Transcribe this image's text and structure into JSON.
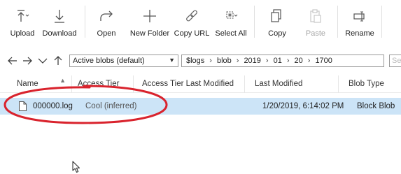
{
  "toolbar": {
    "buttons": [
      {
        "id": "upload",
        "label": "Upload",
        "icon": "upload-icon",
        "enabled": true
      },
      {
        "id": "download",
        "label": "Download",
        "icon": "download-icon",
        "enabled": true
      },
      {
        "id": "open",
        "label": "Open",
        "icon": "open-icon",
        "enabled": true
      },
      {
        "id": "new_folder",
        "label": "New Folder",
        "icon": "plus-icon",
        "enabled": true
      },
      {
        "id": "copy_url",
        "label": "Copy URL",
        "icon": "link-icon",
        "enabled": true
      },
      {
        "id": "select_all",
        "label": "Select All",
        "icon": "select-all-icon",
        "enabled": true
      },
      {
        "id": "copy",
        "label": "Copy",
        "icon": "copy-icon",
        "enabled": true
      },
      {
        "id": "paste",
        "label": "Paste",
        "icon": "paste-icon",
        "enabled": false
      },
      {
        "id": "rename",
        "label": "Rename",
        "icon": "rename-icon",
        "enabled": true
      }
    ]
  },
  "address_bar": {
    "view_filter": "Active blobs (default)",
    "breadcrumb": [
      "$logs",
      "blob",
      "2019",
      "01",
      "20",
      "1700"
    ],
    "search_placeholder": "Sea"
  },
  "table": {
    "columns": [
      "Name",
      "Access Tier",
      "Access Tier Last Modified",
      "Last Modified",
      "Blob Type"
    ],
    "rows": [
      {
        "name": "000000.log",
        "access_tier": "Cool (inferred)",
        "access_tier_last_modified": "",
        "last_modified": "1/20/2019, 6:14:02 PM",
        "blob_type": "Block Blob"
      }
    ]
  },
  "colors": {
    "selection": "#cce4f7",
    "annotation": "#d9232d"
  }
}
